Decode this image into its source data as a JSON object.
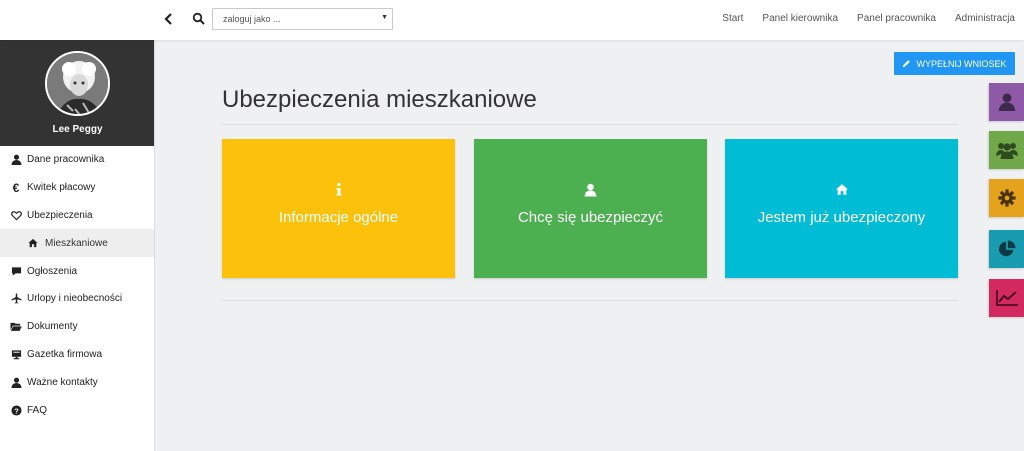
{
  "topbar": {
    "login_placeholder": "zaloguj jako ...",
    "nav": [
      "Start",
      "Panel kierownika",
      "Panel pracownika",
      "Administracja"
    ]
  },
  "profile": {
    "name": "Lee Peggy"
  },
  "sidebar": {
    "items": [
      {
        "label": "Dane pracownika",
        "icon": "user-icon"
      },
      {
        "label": "Kwitek płacowy",
        "icon": "euro-icon"
      },
      {
        "label": "Ubezpieczenia",
        "icon": "heart-icon"
      },
      {
        "label": "Mieszkaniowe",
        "icon": "home-icon"
      },
      {
        "label": "Ogłoszenia",
        "icon": "comment-icon"
      },
      {
        "label": "Urlopy i nieobecności",
        "icon": "plane-icon"
      },
      {
        "label": "Dokumenty",
        "icon": "folder-icon"
      },
      {
        "label": "Gazetka firmowa",
        "icon": "newspaper-icon"
      },
      {
        "label": "Ważne kontakty",
        "icon": "contact-icon"
      },
      {
        "label": "FAQ",
        "icon": "question-icon"
      }
    ]
  },
  "main": {
    "fill_button": "WYPEŁNIJ WNIOSEK",
    "title": "Ubezpieczenia mieszkaniowe",
    "tiles": [
      {
        "label": "Informacje ogólne",
        "icon": "info-icon",
        "color": "#fbc10b"
      },
      {
        "label": "Chcę się ubezpieczyć",
        "icon": "user-icon",
        "color": "#4caf50"
      },
      {
        "label": "Jestem już ubezpieczony",
        "icon": "home-icon",
        "color": "#00bcd4"
      }
    ]
  },
  "side_widgets": [
    {
      "icon": "user-icon",
      "color": "#8e5aa8"
    },
    {
      "icon": "users-icon",
      "color": "#71a84a"
    },
    {
      "icon": "gear-icon",
      "color": "#e5a21d"
    },
    {
      "icon": "pie-chart-icon",
      "color": "#1a9cb0"
    },
    {
      "icon": "line-chart-icon",
      "color": "#d22a5f"
    }
  ]
}
